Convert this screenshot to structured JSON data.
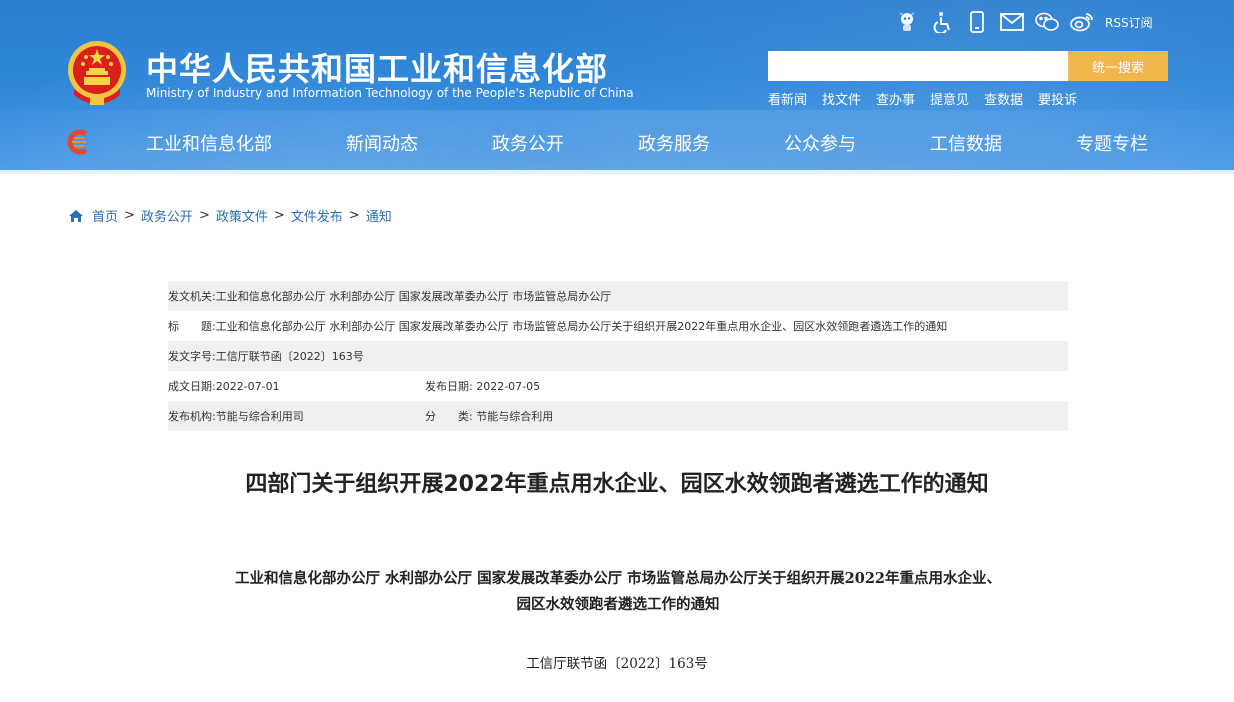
{
  "header": {
    "title": "中华人民共和国工业和信息化部",
    "subtitle": "Ministry of Industry and Information Technology of the People's Republic of China",
    "top_icons": [
      "robot-icon",
      "accessibility-icon",
      "mobile-icon",
      "mail-icon",
      "wechat-icon",
      "weibo-icon"
    ],
    "rss_label": "RSS订阅",
    "search_button": "统一搜索",
    "search_value": "",
    "quick_links": [
      "看新闻",
      "找文件",
      "查办事",
      "提意见",
      "查数据",
      "要投诉"
    ],
    "nav": [
      "工业和信息化部",
      "新闻动态",
      "政务公开",
      "政务服务",
      "公众参与",
      "工信数据",
      "专题专栏"
    ]
  },
  "breadcrumb": [
    "首页",
    "政务公开",
    "政策文件",
    "文件发布",
    "通知"
  ],
  "info": {
    "issuer_label": "发文机关:",
    "issuer_value": "工业和信息化部办公厅 水利部办公厅 国家发展改革委办公厅 市场监管总局办公厅",
    "title_label": "标　　题:",
    "title_value": "工业和信息化部办公厅 水利部办公厅 国家发展改革委办公厅 市场监管总局办公厅关于组织开展2022年重点用水企业、园区水效领跑者遴选工作的通知",
    "docno_label": "发文字号:",
    "docno_value": "工信厅联节函〔2022〕163号",
    "created_label": "成文日期:",
    "created_value": "2022-07-01",
    "published_label": "发布日期:",
    "published_value": "2022-07-05",
    "org_label": "发布机构:",
    "org_value": "节能与综合利用司",
    "category_label": "分　　类:",
    "category_value": "节能与综合利用"
  },
  "article": {
    "title": "四部门关于组织开展2022年重点用水企业、园区水效领跑者遴选工作的通知",
    "subtitle_line1": "工业和信息化部办公厅 水利部办公厅 国家发展改革委办公厅 市场监管总局办公厅关于组织开展2022年重点用水企业、",
    "subtitle_line2": "园区水效领跑者遴选工作的通知",
    "doc_number": "工信厅联节函〔2022〕163号"
  },
  "colors": {
    "header_blue": "#2f86d8",
    "search_orange": "#f3b64d",
    "link_blue": "#2a6fb8",
    "row_gray": "#f0f0f0"
  }
}
